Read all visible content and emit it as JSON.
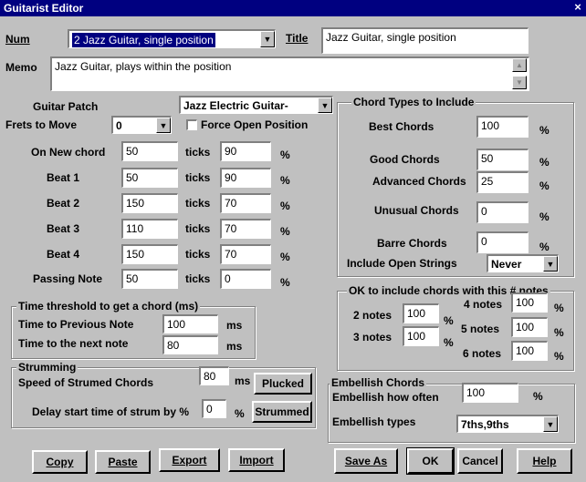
{
  "window": {
    "title": "Guitarist Editor",
    "close": "×"
  },
  "num": {
    "label": "Num",
    "value": "2 Jazz Guitar, single position"
  },
  "title": {
    "label": "Title",
    "value": "Jazz Guitar, single position"
  },
  "memo": {
    "label": "Memo",
    "value": "Jazz Guitar, plays within the position"
  },
  "patch": {
    "label": "Guitar Patch",
    "value": "Jazz Electric Guitar-"
  },
  "frets": {
    "label": "Frets to Move",
    "value": "0"
  },
  "force_open": {
    "label": "Force Open Position",
    "checked": false
  },
  "timing_rows": [
    {
      "label": "On New chord",
      "ticks": "50",
      "ticks_unit": "ticks",
      "pct": "90",
      "pct_unit": "%"
    },
    {
      "label": "Beat 1",
      "ticks": "50",
      "ticks_unit": "ticks",
      "pct": "90",
      "pct_unit": "%"
    },
    {
      "label": "Beat 2",
      "ticks": "150",
      "ticks_unit": "ticks",
      "pct": "70",
      "pct_unit": "%"
    },
    {
      "label": "Beat 3",
      "ticks": "110",
      "ticks_unit": "ticks",
      "pct": "70",
      "pct_unit": "%"
    },
    {
      "label": "Beat 4",
      "ticks": "150",
      "ticks_unit": "ticks",
      "pct": "70",
      "pct_unit": "%"
    },
    {
      "label": "Passing Note",
      "ticks": "50",
      "ticks_unit": "ticks",
      "pct": "0",
      "pct_unit": "%"
    }
  ],
  "threshold": {
    "title": "Time threshold to get a chord (ms)",
    "prev_label": "Time to Previous Note",
    "prev_value": "100",
    "prev_unit": "ms",
    "next_label": "Time to the next note",
    "next_value": "80",
    "next_unit": "ms"
  },
  "strumming": {
    "title": "Strumming",
    "speed_label": "Speed of Strumed Chords",
    "speed_value": "80",
    "speed_unit": "ms",
    "plucked": "Plucked",
    "delay_label": "Delay start time of strum by %",
    "delay_value": "0",
    "delay_unit": "%",
    "strummed": "Strummed"
  },
  "chord_types": {
    "title": "Chord Types to Include",
    "rows": [
      {
        "label": "Best Chords",
        "value": "100",
        "unit": "%"
      },
      {
        "label": "Good Chords",
        "value": "50",
        "unit": "%"
      },
      {
        "label": "Advanced Chords",
        "value": "25",
        "unit": "%"
      },
      {
        "label": "Unusual Chords",
        "value": "0",
        "unit": "%"
      },
      {
        "label": "Barre Chords",
        "value": "0",
        "unit": "%"
      }
    ],
    "open_label": "Include Open Strings",
    "open_value": "Never"
  },
  "notes": {
    "title": "OK to include chords with this # notes",
    "n2_label": "2 notes",
    "n2_value": "100",
    "n3_label": "3 notes",
    "n3_value": "100",
    "n4_label": "4 notes",
    "n4_value": "100",
    "n5_label": "5 notes",
    "n5_value": "100",
    "n6_label": "6 notes",
    "n6_value": "100",
    "unit": "%"
  },
  "embellish": {
    "title": "Embellish Chords",
    "often_label": "Embellish how often",
    "often_value": "100",
    "often_unit": "%",
    "types_label": "Embellish types",
    "types_value": "7ths,9ths"
  },
  "buttons": {
    "copy": "Copy",
    "paste": "Paste",
    "export": "Export",
    "import": "Import",
    "save_as": "Save As",
    "ok": "OK",
    "cancel": "Cancel",
    "help": "Help"
  },
  "icons": {
    "dropdown": "▼",
    "scroll_up": "▲",
    "scroll_down": "▼"
  }
}
